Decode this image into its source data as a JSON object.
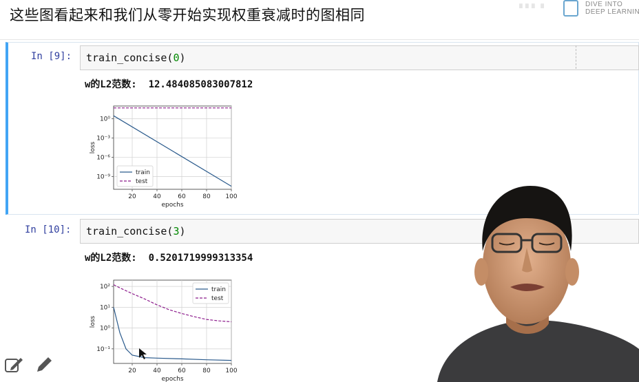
{
  "page_title": "这些图看起来和我们从零开始实现权重衰减时的图相同",
  "logo": {
    "line1": "DIVE INTO",
    "line2": "DEEP LEARNING"
  },
  "cells": [
    {
      "prompt": "In [9]:",
      "code_fn": "train_concise(",
      "code_arg": "0",
      "code_close": ")",
      "output_text": "w的L2范数:  12.484085083007812",
      "chart": {
        "xlabel": "epochs",
        "ylabel": "loss",
        "xticks": [
          "20",
          "40",
          "60",
          "80",
          "100"
        ],
        "yticks": [
          "10⁰",
          "10⁻³",
          "10⁻⁶",
          "10⁻⁹"
        ],
        "legend": [
          "train",
          "test"
        ]
      }
    },
    {
      "prompt": "In [10]:",
      "code_fn": "train_concise(",
      "code_arg": "3",
      "code_close": ")",
      "output_text": "w的L2范数:  0.5201719999313354",
      "chart": {
        "xlabel": "epochs",
        "ylabel": "loss",
        "xticks": [
          "20",
          "40",
          "60",
          "80",
          "100"
        ],
        "yticks": [
          "10²",
          "10¹",
          "10⁰",
          "10⁻¹"
        ],
        "legend": [
          "train",
          "test"
        ]
      }
    }
  ],
  "chart_data": [
    {
      "type": "line",
      "xlabel": "epochs",
      "ylabel": "loss",
      "yscale": "log",
      "xlim": [
        5,
        100
      ],
      "ylim": [
        1e-11,
        100.0
      ],
      "legend_position": "lower-left",
      "grid": true,
      "series": [
        {
          "name": "train",
          "style": "solid",
          "color": "#2a5a8c",
          "x": [
            5,
            100
          ],
          "y": [
            3,
            3e-11
          ]
        },
        {
          "name": "test",
          "style": "dashed",
          "color": "#8b1a8b",
          "x": [
            5,
            100
          ],
          "y": [
            50,
            50
          ]
        }
      ]
    },
    {
      "type": "line",
      "xlabel": "epochs",
      "ylabel": "loss",
      "yscale": "log",
      "xlim": [
        5,
        100
      ],
      "ylim": [
        0.02,
        200
      ],
      "legend_position": "upper-right",
      "grid": true,
      "series": [
        {
          "name": "train",
          "style": "solid",
          "color": "#2a5a8c",
          "x": [
            5,
            10,
            15,
            20,
            30,
            40,
            60,
            80,
            100
          ],
          "y": [
            10,
            0.6,
            0.1,
            0.05,
            0.038,
            0.036,
            0.033,
            0.03,
            0.028
          ]
        },
        {
          "name": "test",
          "style": "dashed",
          "color": "#8b1a8b",
          "x": [
            5,
            10,
            20,
            30,
            40,
            50,
            60,
            70,
            80,
            90,
            100
          ],
          "y": [
            120,
            85,
            45,
            25,
            13,
            7.5,
            5,
            3.5,
            2.6,
            2.2,
            2.0
          ]
        }
      ]
    }
  ]
}
